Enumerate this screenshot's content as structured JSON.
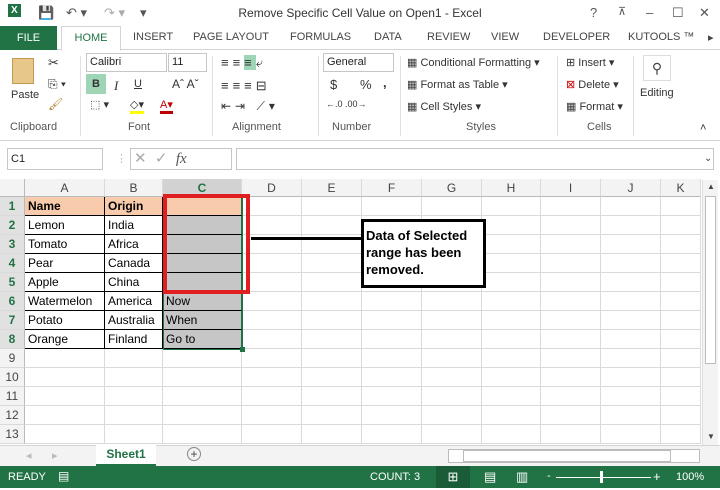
{
  "window": {
    "title": "Remove Specific Cell Value on Open1 - Excel",
    "help": "?",
    "minimize": "–",
    "maximize": "☐",
    "close": "✕"
  },
  "tabs": {
    "file": "FILE",
    "items": [
      "HOME",
      "INSERT",
      "PAGE LAYOUT",
      "FORMULAS",
      "DATA",
      "REVIEW",
      "VIEW",
      "DEVELOPER",
      "KUTOOLS ™"
    ]
  },
  "ribbon": {
    "clipboard": {
      "label": "Clipboard",
      "paste": "Paste"
    },
    "font": {
      "label": "Font",
      "name": "Calibri",
      "size": "11",
      "bold": "B",
      "italic": "I",
      "underline": "U"
    },
    "alignment": {
      "label": "Alignment"
    },
    "number": {
      "label": "Number",
      "format": "General",
      "currency": "$",
      "percent": "%",
      "comma": ","
    },
    "styles": {
      "label": "Styles",
      "conditional": "Conditional Formatting",
      "table": "Format as Table",
      "cell": "Cell Styles"
    },
    "cells": {
      "label": "Cells",
      "insert": "Insert",
      "delete": "Delete",
      "format": "Format"
    },
    "editing": {
      "label": "Editing"
    }
  },
  "formula_bar": {
    "name_box": "C1",
    "fx": "fx",
    "value": ""
  },
  "sheet": {
    "columns": [
      "A",
      "B",
      "C",
      "D",
      "E",
      "F",
      "G",
      "H",
      "I",
      "J",
      "K"
    ],
    "rows": [
      "1",
      "2",
      "3",
      "4",
      "5",
      "6",
      "7",
      "8",
      "9",
      "10",
      "11",
      "12",
      "13"
    ],
    "cells": [
      [
        "Name",
        "Origin",
        ""
      ],
      [
        "Lemon",
        "India",
        ""
      ],
      [
        "Tomato",
        "Africa",
        ""
      ],
      [
        "Pear",
        "Canada",
        ""
      ],
      [
        "Apple",
        "China",
        ""
      ],
      [
        "Watermelon",
        "America",
        "Now"
      ],
      [
        "Potato",
        "Australia",
        "When"
      ],
      [
        "Orange",
        "Finland",
        "Go to"
      ]
    ],
    "header_color": "#f8cbad",
    "selection_color": "#c6c6c6",
    "highlight_color": "#e02020"
  },
  "annotation": "Data of Selected range has been removed.",
  "sheet_tabs": {
    "active": "Sheet1",
    "add": "+"
  },
  "status": {
    "ready": "READY",
    "count": "COUNT: 3",
    "zoom": "100%"
  }
}
